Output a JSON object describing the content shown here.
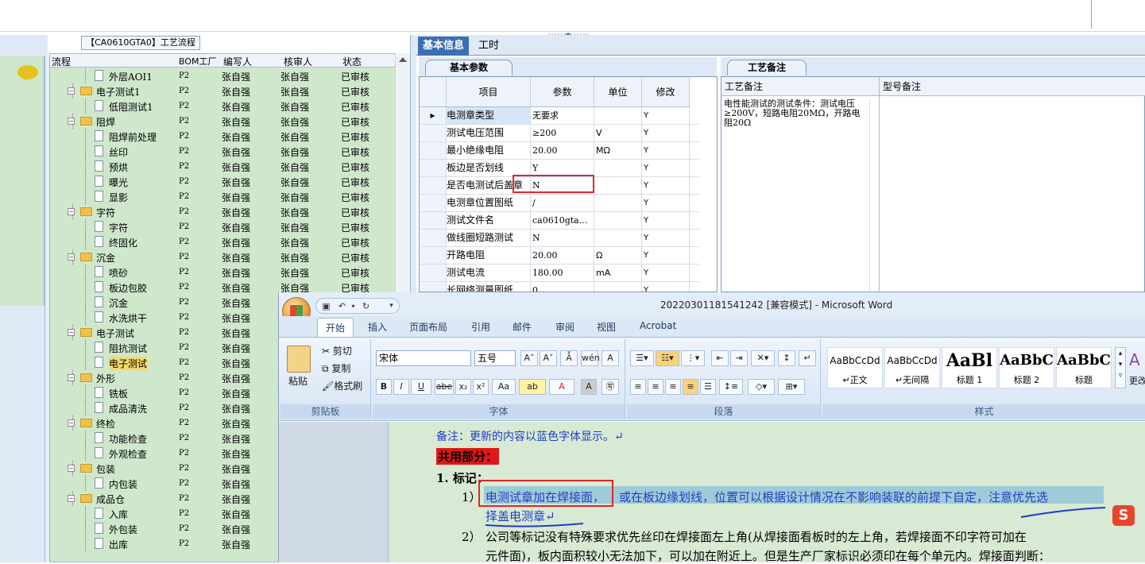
{
  "process_title": "【CA0610GTA0】工艺流程",
  "tree": {
    "headers": {
      "flow": "流程",
      "bom": "BOM工厂",
      "writer": "编写人",
      "reviewer": "核审人",
      "status": "状态"
    },
    "rows": [
      {
        "name": "外层AOI1",
        "level": 2,
        "type": "doc",
        "bom": "P2",
        "writer": "张自强",
        "reviewer": "张自强",
        "status": "已审核"
      },
      {
        "name": "电子测试1",
        "level": 1,
        "type": "folder",
        "bom": "P2",
        "writer": "张自强",
        "reviewer": "张自强",
        "status": "已审核"
      },
      {
        "name": "低阻测试1",
        "level": 2,
        "type": "doc",
        "bom": "P2",
        "writer": "张自强",
        "reviewer": "张自强",
        "status": "已审核"
      },
      {
        "name": "阻焊",
        "level": 1,
        "type": "folder",
        "bom": "P2",
        "writer": "张自强",
        "reviewer": "张自强",
        "status": "已审核"
      },
      {
        "name": "阻焊前处理",
        "level": 2,
        "type": "doc",
        "bom": "P2",
        "writer": "张自强",
        "reviewer": "张自强",
        "status": "已审核"
      },
      {
        "name": "丝印",
        "level": 2,
        "type": "doc",
        "bom": "P2",
        "writer": "张自强",
        "reviewer": "张自强",
        "status": "已审核"
      },
      {
        "name": "预烘",
        "level": 2,
        "type": "doc",
        "bom": "P2",
        "writer": "张自强",
        "reviewer": "张自强",
        "status": "已审核"
      },
      {
        "name": "曝光",
        "level": 2,
        "type": "doc",
        "bom": "P2",
        "writer": "张自强",
        "reviewer": "张自强",
        "status": "已审核"
      },
      {
        "name": "显影",
        "level": 2,
        "type": "doc",
        "bom": "P2",
        "writer": "张自强",
        "reviewer": "张自强",
        "status": "已审核"
      },
      {
        "name": "字符",
        "level": 1,
        "type": "folder",
        "bom": "P2",
        "writer": "张自强",
        "reviewer": "张自强",
        "status": "已审核"
      },
      {
        "name": "字符",
        "level": 2,
        "type": "doc",
        "bom": "P2",
        "writer": "张自强",
        "reviewer": "张自强",
        "status": "已审核"
      },
      {
        "name": "终固化",
        "level": 2,
        "type": "doc",
        "bom": "P2",
        "writer": "张自强",
        "reviewer": "张自强",
        "status": "已审核"
      },
      {
        "name": "沉金",
        "level": 1,
        "type": "folder",
        "bom": "P2",
        "writer": "张自强",
        "reviewer": "张自强",
        "status": "已审核"
      },
      {
        "name": "喷砂",
        "level": 2,
        "type": "doc",
        "bom": "P2",
        "writer": "张自强",
        "reviewer": "张自强",
        "status": "已审核"
      },
      {
        "name": "板边包胶",
        "level": 2,
        "type": "doc",
        "bom": "P2",
        "writer": "张自强",
        "reviewer": "张自强",
        "status": "已审核"
      },
      {
        "name": "沉金",
        "level": 2,
        "type": "doc",
        "bom": "P2",
        "writer": "张自强",
        "reviewer": "",
        "status": ""
      },
      {
        "name": "水洗烘干",
        "level": 2,
        "type": "doc",
        "bom": "P2",
        "writer": "张自强",
        "reviewer": "",
        "status": ""
      },
      {
        "name": "电子测试",
        "level": 1,
        "type": "folder",
        "bom": "P2",
        "writer": "张自强",
        "reviewer": "",
        "status": ""
      },
      {
        "name": "阻抗测试",
        "level": 2,
        "type": "doc",
        "bom": "P2",
        "writer": "张自强",
        "reviewer": "",
        "status": ""
      },
      {
        "name": "电子测试",
        "level": 2,
        "type": "doc",
        "bom": "P2",
        "writer": "张自强",
        "reviewer": "",
        "status": "",
        "selected": true
      },
      {
        "name": "外形",
        "level": 1,
        "type": "folder",
        "bom": "P2",
        "writer": "张自强",
        "reviewer": "",
        "status": ""
      },
      {
        "name": "铣板",
        "level": 2,
        "type": "doc",
        "bom": "P2",
        "writer": "张自强",
        "reviewer": "",
        "status": ""
      },
      {
        "name": "成品清洗",
        "level": 2,
        "type": "doc",
        "bom": "P2",
        "writer": "张自强",
        "reviewer": "",
        "status": ""
      },
      {
        "name": "终检",
        "level": 1,
        "type": "folder",
        "bom": "P2",
        "writer": "张自强",
        "reviewer": "",
        "status": ""
      },
      {
        "name": "功能检查",
        "level": 2,
        "type": "doc",
        "bom": "P2",
        "writer": "张自强",
        "reviewer": "",
        "status": ""
      },
      {
        "name": "外观检查",
        "level": 2,
        "type": "doc",
        "bom": "P2",
        "writer": "张自强",
        "reviewer": "",
        "status": ""
      },
      {
        "name": "包装",
        "level": 1,
        "type": "folder",
        "bom": "P2",
        "writer": "张自强",
        "reviewer": "",
        "status": ""
      },
      {
        "name": "内包装",
        "level": 2,
        "type": "doc",
        "bom": "P2",
        "writer": "张自强",
        "reviewer": "",
        "status": ""
      },
      {
        "name": "成品仓",
        "level": 1,
        "type": "folder",
        "bom": "P2",
        "writer": "张自强",
        "reviewer": "",
        "status": ""
      },
      {
        "name": "入库",
        "level": 2,
        "type": "doc",
        "bom": "P2",
        "writer": "张自强",
        "reviewer": "",
        "status": ""
      },
      {
        "name": "外包装",
        "level": 2,
        "type": "doc",
        "bom": "P2",
        "writer": "张自强",
        "reviewer": "",
        "status": ""
      },
      {
        "name": "出库",
        "level": 2,
        "type": "doc",
        "bom": "P2",
        "writer": "张自强",
        "reviewer": "",
        "status": ""
      }
    ]
  },
  "tabs": {
    "basic": "基本信息",
    "hours": "工时"
  },
  "params": {
    "subtab": "基本参数",
    "headers": {
      "item": "项目",
      "value": "参数",
      "unit": "单位",
      "modify": "修改"
    },
    "rows": [
      {
        "item": "电测章类型",
        "value": "无要求",
        "unit": "",
        "modify": "Y",
        "current": true
      },
      {
        "item": "测试电压范围",
        "value": "≥200",
        "unit": "V",
        "modify": "Y"
      },
      {
        "item": "最小绝缘电阻",
        "value": "20.00",
        "unit": "MΩ",
        "modify": "Y"
      },
      {
        "item": "板边是否划线",
        "value": "Y",
        "unit": "",
        "modify": "Y"
      },
      {
        "item": "是否电测试后盖章",
        "value": "N",
        "unit": "",
        "modify": "Y"
      },
      {
        "item": "电测章位置图纸",
        "value": "/",
        "unit": "",
        "modify": "Y"
      },
      {
        "item": "测试文件名",
        "value": "ca0610gta...",
        "unit": "",
        "modify": "Y"
      },
      {
        "item": "做线圈短路测试",
        "value": "N",
        "unit": "",
        "modify": "Y"
      },
      {
        "item": "开路电阻",
        "value": "20.00",
        "unit": "Ω",
        "modify": "Y"
      },
      {
        "item": "测试电流",
        "value": "180.00",
        "unit": "mA",
        "modify": "Y"
      },
      {
        "item": "长网络测量图纸",
        "value": "0",
        "unit": "",
        "modify": "Y"
      }
    ]
  },
  "remarks": {
    "subtab": "工艺备注",
    "col1": "工艺备注",
    "col2": "型号备注",
    "text": "电性能测试的测试条件：测试电压≥200V，短路电阻20MΩ，开路电阻20Ω"
  },
  "word": {
    "title": "20220301181541242 [兼容模式] - Microsoft Word",
    "tabs": [
      "开始",
      "插入",
      "页面布局",
      "引用",
      "邮件",
      "审阅",
      "视图",
      "Acrobat"
    ],
    "clipboard": {
      "paste": "粘贴",
      "cut": "剪切",
      "copy": "复制",
      "format_painter": "格式刷",
      "label": "剪贴板"
    },
    "font": {
      "name": "宋体",
      "size": "五号",
      "label": "字体"
    },
    "paragraph_label": "段落",
    "styles": {
      "label": "样式",
      "more": "更改",
      "items": [
        {
          "preview": "AaBbCcDd",
          "name": "↵正文"
        },
        {
          "preview": "AaBbCcDd",
          "name": "↵无间隔"
        },
        {
          "preview": "AaBl",
          "name": "标题 1"
        },
        {
          "preview": "AaBbC",
          "name": "标题 2"
        },
        {
          "preview": "AaBbC",
          "name": "标题"
        }
      ]
    },
    "doc": {
      "note": "备注：更新的内容以蓝色字体显示。↵",
      "common": "共用部分：",
      "heading": "1.   标记：",
      "item1_num": "1）",
      "item1_a": "电测试章加在焊接面，",
      "item1_b": "或在板边缘划线，位置可以根据设计情况在不影响装联的前提下自定，注意优先选",
      "item1_c": "择盖电测章↵",
      "item2_num": "2）",
      "item2_a": "公司等标记没有特殊要求优先丝印在焊接面左上角(从焊接面看板时的左上角，若焊接面不印字符可加在",
      "item2_b": "元件面)，板内面积较小无法加下，可以加在附近上。但是生产厂家标识必须印在每个单元内。焊接面判断："
    }
  },
  "colors": {
    "accent": "#3a6fb5",
    "tree_bg": "#cfe8cc",
    "highlight_red": "#e0262a",
    "doc_blue": "#1f3fc4"
  }
}
